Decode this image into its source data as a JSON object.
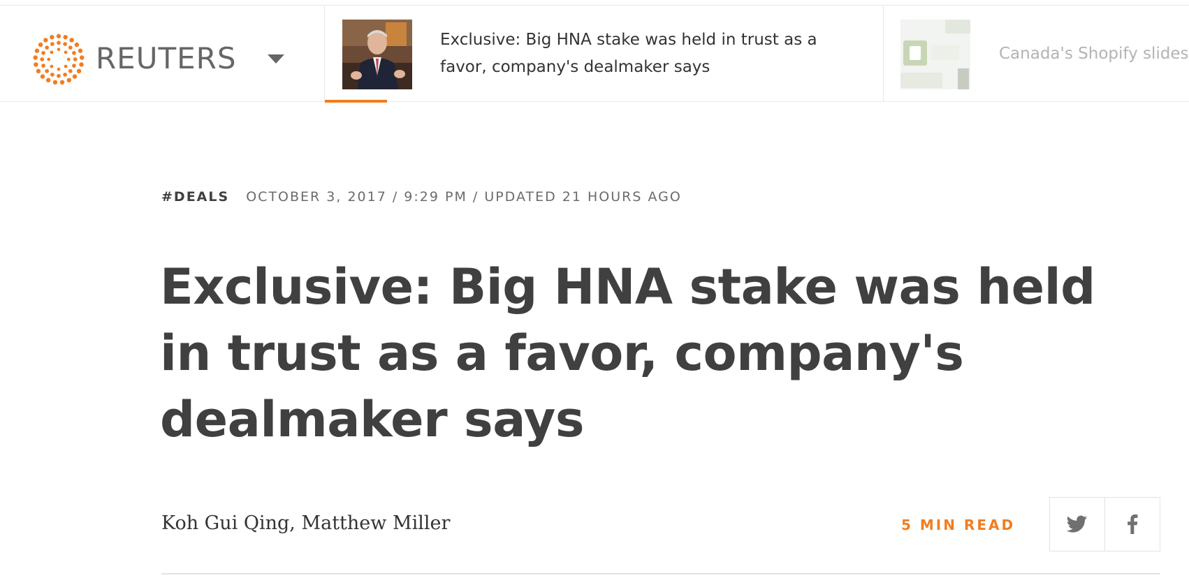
{
  "header": {
    "brand_name": "REUTERS",
    "brand_color": "#f27d20",
    "menu_icon": "chevron-down-icon"
  },
  "ticker": [
    {
      "title": "Exclusive: Big HNA stake was held in trust as a favor, company's dealmaker says",
      "active": true
    },
    {
      "title": "Canada's Shopify slides",
      "active": false
    }
  ],
  "article": {
    "tag": "#DEALS",
    "meta": "OCTOBER 3, 2017 / 9:29 PM / UPDATED 21 HOURS AGO",
    "headline": "Exclusive: Big HNA stake was held in trust as a favor, company's dealmaker says",
    "byline": "Koh Gui Qing, Matthew Miller",
    "read_time": "5 MIN READ"
  },
  "share": {
    "twitter_icon": "twitter-icon",
    "facebook_icon": "facebook-icon"
  },
  "colors": {
    "accent": "#f27d20",
    "text": "#404040",
    "muted": "#6b6b6b"
  }
}
